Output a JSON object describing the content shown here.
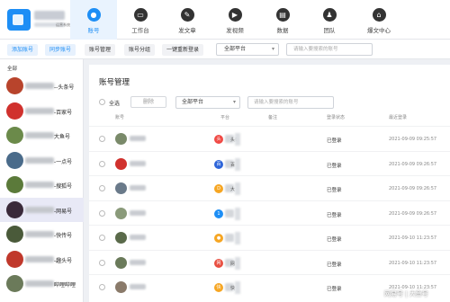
{
  "app": {
    "logo_subtext": "运营系统"
  },
  "nav": [
    {
      "label": "账号",
      "icon": "user-icon",
      "glyph": "●",
      "active": true
    },
    {
      "label": "工作台",
      "icon": "monitor-icon",
      "glyph": "▭"
    },
    {
      "label": "发文章",
      "icon": "edit-icon",
      "glyph": "✎"
    },
    {
      "label": "发视频",
      "icon": "video-icon",
      "glyph": "▶"
    },
    {
      "label": "数据",
      "icon": "chart-icon",
      "glyph": "▤"
    },
    {
      "label": "团队",
      "icon": "team-icon",
      "glyph": "♟"
    },
    {
      "label": "爆文中心",
      "icon": "home-icon",
      "glyph": "⌂"
    }
  ],
  "subbar": {
    "add": "添加账号",
    "sync": "同步账号",
    "manage": "账号管理",
    "group": "账号分组",
    "relogin": "一键重新登录",
    "platform": "全部平台",
    "search_placeholder": "请输入要搜索的账号"
  },
  "sidebar": {
    "all": "全部",
    "accounts": [
      {
        "name": "--头条号"
      },
      {
        "name": "-百家号"
      },
      {
        "name": "大鱼号"
      },
      {
        "name": "-一点号"
      },
      {
        "name": "-搜狐号"
      },
      {
        "name": "-网易号",
        "selected": true
      },
      {
        "name": "-快传号"
      },
      {
        "name": "-趣头号"
      },
      {
        "name": "哔哩哔哩"
      }
    ]
  },
  "main": {
    "title": "账号管理",
    "select_all": "全选",
    "delete": "删除",
    "platform": "全部平台",
    "search_placeholder": "请输入要搜索的账号",
    "columns": {
      "account": "账号",
      "platform": "平台",
      "note": "备注",
      "status": "登录状态",
      "last": "最近登录"
    },
    "rows": [
      {
        "plat_name": "头条",
        "plat_glyph": "头",
        "plat_color": "#f04a45",
        "status": "已登录",
        "time": "2021-09-09 09:25:57"
      },
      {
        "plat_name": "百",
        "plat_glyph": "百",
        "plat_color": "#2e65d9",
        "status": "已登录",
        "time": "2021-09-09 09:26:57"
      },
      {
        "plat_name": "大",
        "plat_glyph": "D",
        "plat_color": "#f6a623",
        "status": "已登录",
        "time": "2021-09-09 09:26:57"
      },
      {
        "plat_name": "",
        "plat_glyph": "1",
        "plat_color": "#1d8ef5",
        "status": "已登录",
        "time": "2021-09-09 09:26:57"
      },
      {
        "plat_name": "",
        "plat_glyph": "●",
        "plat_color": "#f6a623",
        "status": "已登录",
        "time": "2021-09-10 11:23:57"
      },
      {
        "plat_name": "网",
        "plat_glyph": "网",
        "plat_color": "#e84e40",
        "status": "已登录",
        "time": "2021-09-10 11:23:57"
      },
      {
        "plat_name": "快",
        "plat_glyph": "快",
        "plat_color": "#f6a623",
        "status": "已登录",
        "time": "2021-09-10 11:23:57"
      }
    ]
  },
  "watermark": "网易号 | 大鱼号"
}
